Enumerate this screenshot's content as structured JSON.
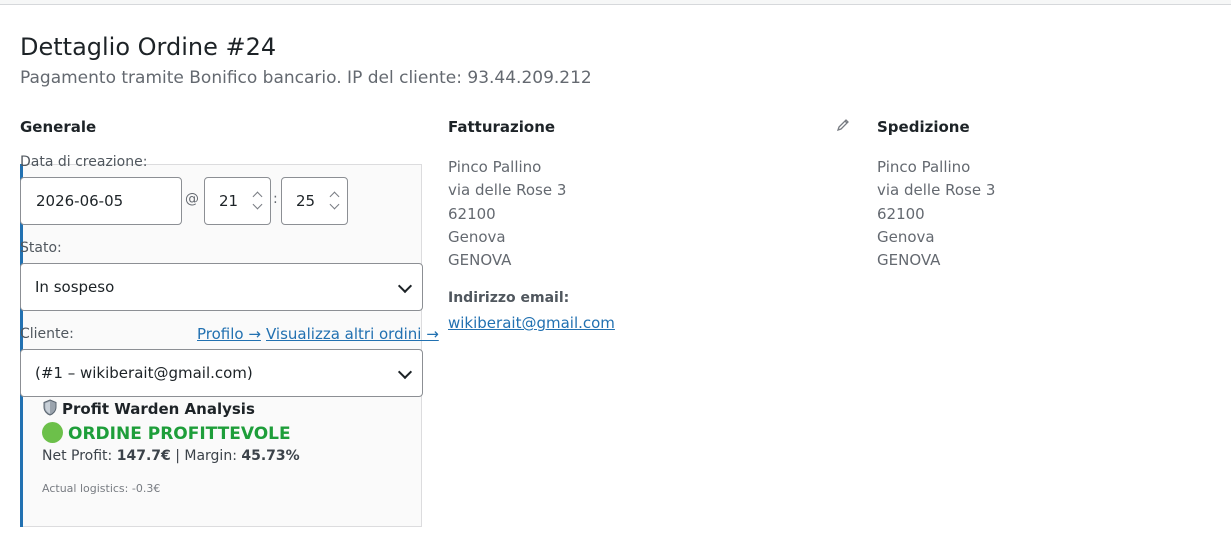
{
  "header": {
    "title": "Dettaglio Ordine #24",
    "subtitle": "Pagamento tramite Bonifico bancario. IP del cliente: 93.44.209.212"
  },
  "generale": {
    "heading": "Generale",
    "date_label": "Data di creazione:",
    "date_value": "2026-06-05",
    "at_sign": "@",
    "hour": "21",
    "colon": ":",
    "minute": "25",
    "status_label": "Stato:",
    "status_value": "In sospeso",
    "client_label": "Cliente:",
    "profile_link": "Profilo →",
    "other_orders_link": "Visualizza altri ordini →",
    "client_value": "(#1 – wikiberait@gmail.com)"
  },
  "profit_warden": {
    "title_icon": "shield-icon",
    "title": "Profit Warden Analysis",
    "status_icon": "green-circle-icon",
    "status": "ORDINE PROFITTEVOLE",
    "net_profit_label": "Net Profit:",
    "net_profit_value": "147.7€",
    "separator": "|",
    "margin_label": "Margin:",
    "margin_value": "45.73%",
    "logistics": "Actual logistics: -0.3€",
    "status_color": "#1e9e3a"
  },
  "fatturazione": {
    "heading": "Fatturazione",
    "edit_icon": "pencil-icon",
    "name": "Pinco Pallino",
    "street": "via delle Rose 3",
    "zip": "62100",
    "city": "Genova",
    "province": "GENOVA",
    "email_label": "Indirizzo email:",
    "email": "wikiberait@gmail.com"
  },
  "spedizione": {
    "heading": "Spedizione",
    "name": "Pinco Pallino",
    "street": "via delle Rose 3",
    "zip": "62100",
    "city": "Genova",
    "province": "GENOVA"
  },
  "colors": {
    "accent": "#2271b1",
    "profit_green": "#1e9e3a"
  }
}
